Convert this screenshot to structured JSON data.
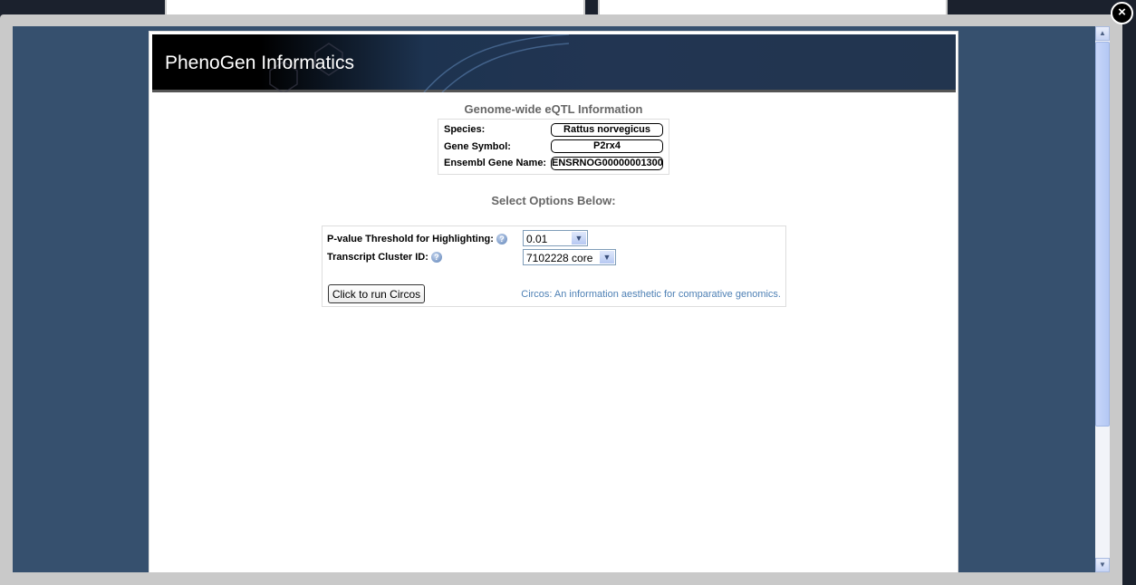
{
  "header": {
    "logo": "PhenoGen Informatics"
  },
  "info": {
    "title": "Genome-wide eQTL Information",
    "rows": [
      {
        "label": "Species:",
        "value": "Rattus norvegicus"
      },
      {
        "label": "Gene Symbol:",
        "value": "P2rx4"
      },
      {
        "label": "Ensembl Gene Name:",
        "value": "ENSRNOG00000001300"
      }
    ]
  },
  "options": {
    "title": "Select Options Below:",
    "pvalue_label": "P-value Threshold for Highlighting:",
    "pvalue_value": "0.01",
    "cluster_label": "Transcript Cluster ID:",
    "cluster_value": "7102228 core",
    "run_button": "Click to run Circos",
    "circos_link": "Circos: An information aesthetic for comparative genomics."
  },
  "help_glyph": "?",
  "close_glyph": "×"
}
